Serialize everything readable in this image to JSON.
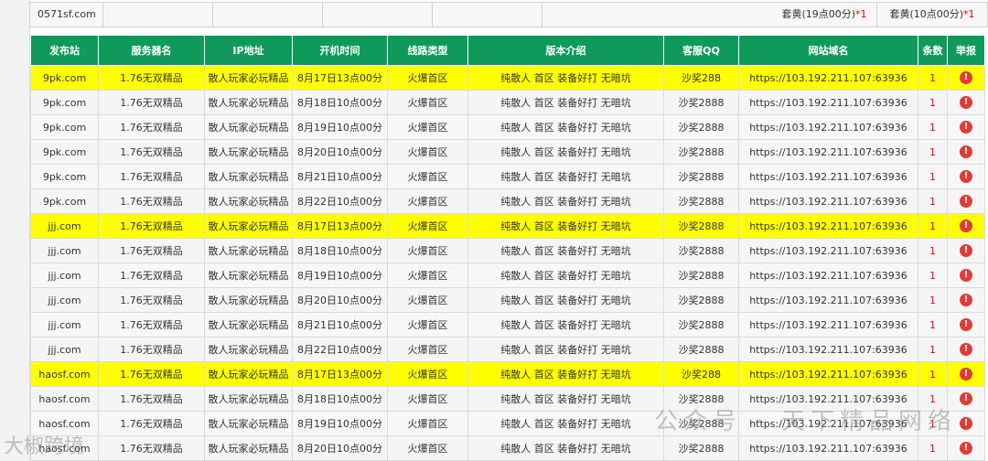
{
  "top_bar": {
    "site": "0571sf.com",
    "pkg1": "套黄(19点00分)",
    "pkg1_star": "*1",
    "pkg2": "套黄(10点00分)",
    "pkg2_star": "*1"
  },
  "headers": [
    "发布站",
    "服务器名",
    "IP地址",
    "开机时间",
    "线路类型",
    "版本介绍",
    "客服QQ",
    "网站域名",
    "条数",
    "举报"
  ],
  "rows": [
    {
      "hl": true,
      "site": "9pk.com",
      "name": "1.76无双精品",
      "ip": "散人玩家必玩精品",
      "time": "8月17日13点00分",
      "line": "火爆首区",
      "intro": "纯散人 首区 装备好打 无暗坑",
      "qq": "沙奖288",
      "domain": "https://103.192.211.107:63936",
      "count": "1",
      "blk": true
    },
    {
      "hl": false,
      "site": "9pk.com",
      "name": "1.76无双精品",
      "ip": "散人玩家必玩精品",
      "time": "8月18日10点00分",
      "line": "火爆首区",
      "intro": "纯散人 首区 装备好打 无暗坑",
      "qq": "沙奖2888",
      "domain": "https://103.192.211.107:63936",
      "count": "1",
      "blk": true
    },
    {
      "hl": false,
      "site": "9pk.com",
      "name": "1.76无双精品",
      "ip": "散人玩家必玩精品",
      "time": "8月19日10点00分",
      "line": "火爆首区",
      "intro": "纯散人 首区 装备好打 无暗坑",
      "qq": "沙奖2888",
      "domain": "https://103.192.211.107:63936",
      "count": "1",
      "blk": true
    },
    {
      "hl": false,
      "site": "9pk.com",
      "name": "1.76无双精品",
      "ip": "散人玩家必玩精品",
      "time": "8月20日10点00分",
      "line": "火爆首区",
      "intro": "纯散人 首区 装备好打 无暗坑",
      "qq": "沙奖2888",
      "domain": "https://103.192.211.107:63936",
      "count": "1",
      "blk": true
    },
    {
      "hl": false,
      "site": "9pk.com",
      "name": "1.76无双精品",
      "ip": "散人玩家必玩精品",
      "time": "8月21日10点00分",
      "line": "火爆首区",
      "intro": "纯散人 首区 装备好打 无暗坑",
      "qq": "沙奖2888",
      "domain": "https://103.192.211.107:63936",
      "count": "1",
      "blk": true
    },
    {
      "hl": false,
      "site": "9pk.com",
      "name": "1.76无双精品",
      "ip": "散人玩家必玩精品",
      "time": "8月22日10点00分",
      "line": "火爆首区",
      "intro": "纯散人 首区 装备好打 无暗坑",
      "qq": "沙奖2888",
      "domain": "https://103.192.211.107:63936",
      "count": "1",
      "blk": true
    },
    {
      "hl": true,
      "site": "jjj.com",
      "name": "1.76无双精品",
      "ip": "散人玩家必玩精品",
      "time": "8月17日13点00分",
      "line": "火爆首区",
      "intro": "纯散人 首区 装备好打 无暗坑",
      "qq": "沙奖2888",
      "domain": "https://103.192.211.107:63936",
      "count": "1",
      "blk": false
    },
    {
      "hl": false,
      "site": "jjj.com",
      "name": "1.76无双精品",
      "ip": "散人玩家必玩精品",
      "time": "8月18日10点00分",
      "line": "火爆首区",
      "intro": "纯散人 首区 装备好打 无暗坑",
      "qq": "沙奖2888",
      "domain": "https://103.192.211.107:63936",
      "count": "1",
      "blk": false
    },
    {
      "hl": false,
      "site": "jjj.com",
      "name": "1.76无双精品",
      "ip": "散人玩家必玩精品",
      "time": "8月19日10点00分",
      "line": "火爆首区",
      "intro": "纯散人 首区 装备好打 无暗坑",
      "qq": "沙奖2888",
      "domain": "https://103.192.211.107:63936",
      "count": "1",
      "blk": false
    },
    {
      "hl": false,
      "site": "jjj.com",
      "name": "1.76无双精品",
      "ip": "散人玩家必玩精品",
      "time": "8月20日10点00分",
      "line": "火爆首区",
      "intro": "纯散人 首区 装备好打 无暗坑",
      "qq": "沙奖2888",
      "domain": "https://103.192.211.107:63936",
      "count": "1",
      "blk": false
    },
    {
      "hl": false,
      "site": "jjj.com",
      "name": "1.76无双精品",
      "ip": "散人玩家必玩精品",
      "time": "8月21日10点00分",
      "line": "火爆首区",
      "intro": "纯散人 首区 装备好打 无暗坑",
      "qq": "沙奖2888",
      "domain": "https://103.192.211.107:63936",
      "count": "1",
      "blk": false
    },
    {
      "hl": false,
      "site": "jjj.com",
      "name": "1.76无双精品",
      "ip": "散人玩家必玩精品",
      "time": "8月22日10点00分",
      "line": "火爆首区",
      "intro": "纯散人 首区 装备好打 无暗坑",
      "qq": "沙奖2888",
      "domain": "https://103.192.211.107:63936",
      "count": "1",
      "blk": false
    },
    {
      "hl": true,
      "site": "haosf.com",
      "name": "1.76无双精品",
      "ip": "散人玩家必玩精品",
      "time": "8月17日13点00分",
      "line": "火爆首区",
      "intro": "纯散人 首区 装备好打 无暗坑",
      "qq": "沙奖288",
      "domain": "https://103.192.211.107:63936",
      "count": "1",
      "blk": true
    },
    {
      "hl": false,
      "site": "haosf.com",
      "name": "1.76无双精品",
      "ip": "散人玩家必玩精品",
      "time": "8月18日10点00分",
      "line": "火爆首区",
      "intro": "纯散人 首区 装备好打 无暗坑",
      "qq": "沙奖2888",
      "domain": "https://103.192.211.107:63936",
      "count": "1",
      "blk": true
    },
    {
      "hl": false,
      "site": "haosf.com",
      "name": "1.76无双精品",
      "ip": "散人玩家必玩精品",
      "time": "8月19日10点00分",
      "line": "火爆首区",
      "intro": "纯散人 首区 装备好打 无暗坑",
      "qq": "沙奖2888",
      "domain": "https://103.192.211.107:63936",
      "count": "1",
      "blk": true
    },
    {
      "hl": false,
      "site": "haosf.com",
      "name": "1.76无双精品",
      "ip": "散人玩家必玩精品",
      "time": "8月20日10点00分",
      "line": "火爆首区",
      "intro": "纯散人 首区 装备好打 无暗坑",
      "qq": "沙奖2888",
      "domain": "https://103.192.211.107:63936",
      "count": "1",
      "blk": true
    }
  ],
  "report_icon": "report-icon",
  "watermark": "公众号 · 天下精品网络",
  "watermark2": "大椒跨境",
  "colors": {
    "header_bg": "#0f9a5c",
    "highlight": "#ffff00",
    "count": "#e00000",
    "report": "#e53935"
  }
}
